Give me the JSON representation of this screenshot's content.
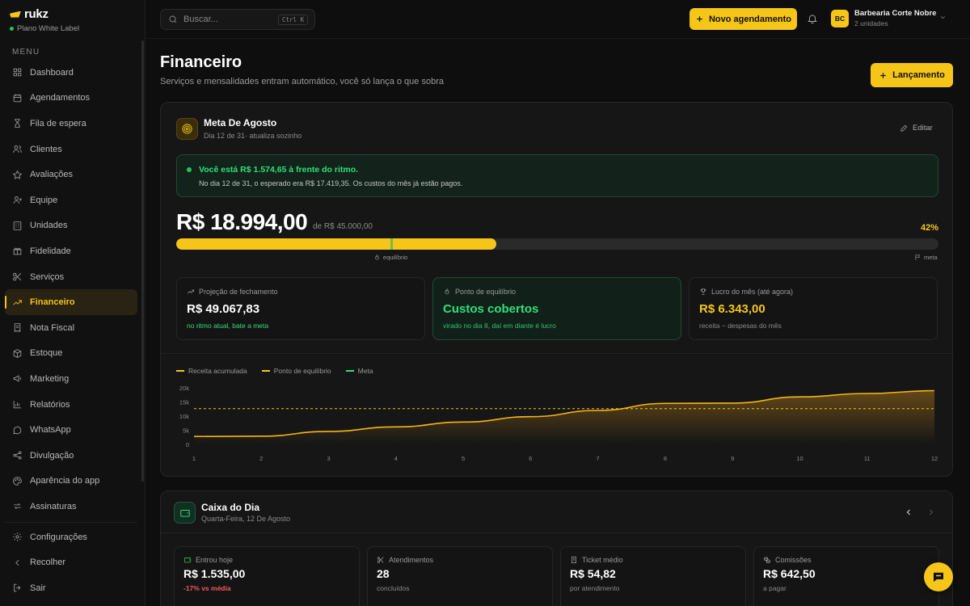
{
  "brand": {
    "name": "rukz",
    "plan": "Plano White Label"
  },
  "sidebar": {
    "menu_label": "MENU",
    "items": [
      {
        "label": "Dashboard",
        "icon": "grid-icon"
      },
      {
        "label": "Agendamentos",
        "icon": "calendar-icon"
      },
      {
        "label": "Fila de espera",
        "icon": "hourglass-icon"
      },
      {
        "label": "Clientes",
        "icon": "users-icon"
      },
      {
        "label": "Avaliações",
        "icon": "star-icon"
      },
      {
        "label": "Equipe",
        "icon": "user-plus-icon"
      },
      {
        "label": "Unidades",
        "icon": "building-icon"
      },
      {
        "label": "Fidelidade",
        "icon": "gift-icon"
      },
      {
        "label": "Serviços",
        "icon": "scissors-icon"
      },
      {
        "label": "Financeiro",
        "icon": "trending-up-icon",
        "active": true
      },
      {
        "label": "Nota Fiscal",
        "icon": "receipt-icon"
      },
      {
        "label": "Estoque",
        "icon": "box-icon"
      },
      {
        "label": "Marketing",
        "icon": "megaphone-icon"
      },
      {
        "label": "Relatórios",
        "icon": "bar-chart-icon"
      },
      {
        "label": "WhatsApp",
        "icon": "chat-icon"
      },
      {
        "label": "Divulgação",
        "icon": "share-icon"
      },
      {
        "label": "Aparência do app",
        "icon": "palette-icon"
      },
      {
        "label": "Assinaturas",
        "icon": "repeat-icon"
      }
    ],
    "bottom": [
      {
        "label": "Configurações",
        "icon": "gear-icon"
      },
      {
        "label": "Recolher",
        "icon": "chevron-left-icon"
      },
      {
        "label": "Sair",
        "icon": "logout-icon"
      }
    ]
  },
  "topbar": {
    "search_placeholder": "Buscar...",
    "search_shortcut": "Ctrl K",
    "new_button": "Novo agendamento",
    "account_initials": "BC",
    "account_name": "Barbearia Corte Nobre",
    "account_sub": "2 unidades"
  },
  "page": {
    "title": "Financeiro",
    "subtitle": "Serviços e mensalidades entram automático, você só lança o que sobra",
    "launch_button": "Lançamento"
  },
  "goal": {
    "title": "Meta De Agosto",
    "subtitle": "Dia 12 de 31· atualiza sozinho",
    "edit_label": "Editar",
    "alert_title": "Você está R$ 1.574,65 à frente do ritmo.",
    "alert_desc": "No dia 12 de 31, o esperado era R$ 17.419,35. Os custos do mês já estão pagos.",
    "current": "R$ 18.994,00",
    "of_label": "de R$ 45.000,00",
    "percent_label": "42%",
    "progress_fraction": 0.42,
    "equilibrium_fraction": 0.282,
    "equilibrium_label": "equilíbrio",
    "goal_label": "meta",
    "colors": {
      "accent": "#f5c518",
      "green": "#2ee07a"
    }
  },
  "stats": [
    {
      "label": "Projeção de fechamento",
      "icon": "trending-up-icon",
      "value": "R$ 49.067,83",
      "note": "no ritmo atual, bate a meta",
      "variant": "plain",
      "value_color": "#ffffff",
      "note_color": "#2ee07a"
    },
    {
      "label": "Ponto de equilíbrio",
      "icon": "flame-icon",
      "value": "Custos cobertos",
      "note": "virado no dia 8, daí em diante é lucro",
      "variant": "green",
      "value_color": "#2ee07a",
      "note_color": "#2ec46e"
    },
    {
      "label": "Lucro do mês (até agora)",
      "icon": "trophy-icon",
      "value": "R$ 6.343,00",
      "note": "receita − despesas do mês",
      "variant": "plain",
      "value_color": "#f5c518",
      "note_color": "#8a8a8a"
    }
  ],
  "chart_data": {
    "type": "line",
    "x": [
      1,
      2,
      3,
      4,
      5,
      6,
      7,
      8,
      9,
      10,
      11,
      12
    ],
    "series": [
      {
        "name": "Receita acumulada",
        "color": "#f5b41a",
        "values": [
          2800,
          2900,
          4600,
          6200,
          7900,
          9800,
          12000,
          14500,
          14600,
          16800,
          18000,
          19000
        ]
      },
      {
        "name": "Ponto de equilíbrio",
        "color": "#f5c518",
        "values": [
          12650,
          12650,
          12650,
          12650,
          12650,
          12650,
          12650,
          12650,
          12650,
          12650,
          12650,
          12650
        ]
      }
    ],
    "legend": [
      {
        "name": "Receita acumulada",
        "color": "#f5c518"
      },
      {
        "name": "Ponto de equilíbrio",
        "color": "#f5c518"
      },
      {
        "name": "Meta",
        "color": "#2ee07a"
      }
    ],
    "yticks": [
      "0",
      "5k",
      "10k",
      "15k",
      "20k"
    ],
    "ylim": [
      0,
      20000
    ],
    "grid": false,
    "legend_position": "top-left"
  },
  "cash": {
    "title": "Caixa do Dia",
    "subtitle": "Quarta-Feira, 12 De Agosto",
    "kpis": [
      {
        "label": "Entrou hoje",
        "icon": "wallet-icon",
        "value": "R$ 1.535,00",
        "note": "-17% vs média",
        "note_red": true
      },
      {
        "label": "Atendimentos",
        "icon": "scissors-icon",
        "value": "28",
        "note": "concluídos",
        "note_red": false
      },
      {
        "label": "Ticket médio",
        "icon": "receipt-icon",
        "value": "R$ 54,82",
        "note": "por atendimento",
        "note_red": false
      },
      {
        "label": "Comissões",
        "icon": "coins-icon",
        "value": "R$ 642,50",
        "note": "a pagar",
        "note_red": false
      }
    ]
  }
}
